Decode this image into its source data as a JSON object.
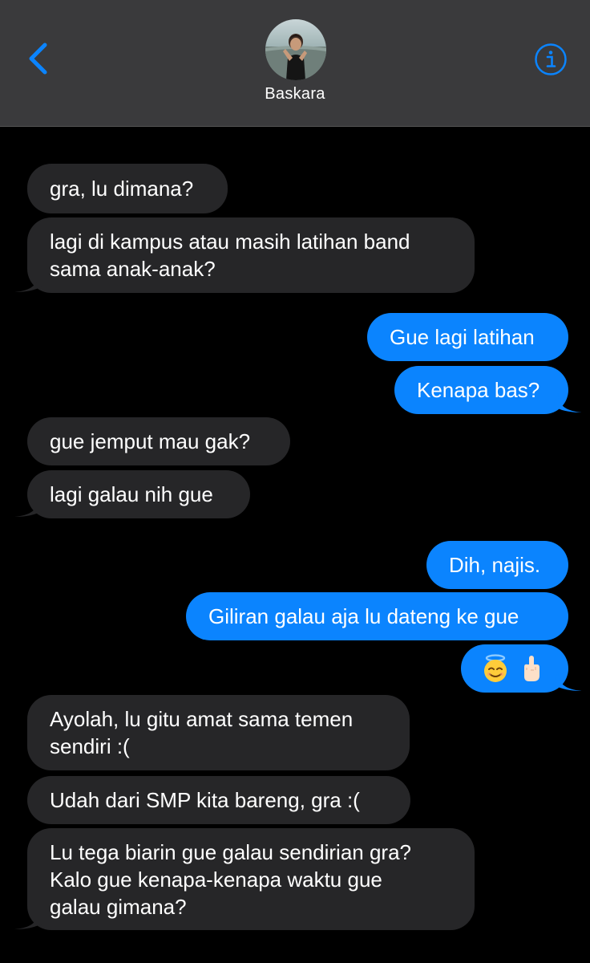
{
  "header": {
    "contact_name": "Baskara",
    "back_icon": "chevron-left-icon",
    "info_icon": "info-icon",
    "accent_color": "#0b84fe"
  },
  "colors": {
    "header_bg": "#3a3a3c",
    "received_bubble": "#262628",
    "sent_bubble": "#0b84fe",
    "background": "#000000"
  },
  "messages": [
    {
      "from": "received",
      "lines": [
        "gra, lu dimana?"
      ]
    },
    {
      "from": "received",
      "lines": [
        "lagi di kampus atau masih latihan band",
        "sama anak-anak?"
      ]
    },
    {
      "from": "sent",
      "lines": [
        "Gue lagi latihan"
      ]
    },
    {
      "from": "sent",
      "lines": [
        "Kenapa bas?"
      ]
    },
    {
      "from": "received",
      "lines": [
        "gue jemput mau gak?"
      ]
    },
    {
      "from": "received",
      "lines": [
        "lagi galau nih gue"
      ]
    },
    {
      "from": "sent",
      "lines": [
        "Dih, najis."
      ]
    },
    {
      "from": "sent",
      "lines": [
        "Giliran galau aja lu dateng ke gue"
      ]
    },
    {
      "from": "sent",
      "emoji": [
        "smiling-face-with-halo",
        "middle-finger"
      ]
    },
    {
      "from": "received",
      "lines": [
        "Ayolah, lu gitu amat sama temen",
        "sendiri :("
      ]
    },
    {
      "from": "received",
      "lines": [
        "Udah dari SMP kita bareng, gra :("
      ]
    },
    {
      "from": "received",
      "lines": [
        "Lu tega biarin gue galau sendirian gra?",
        "Kalo gue kenapa-kenapa waktu gue",
        "galau gimana?"
      ]
    }
  ]
}
